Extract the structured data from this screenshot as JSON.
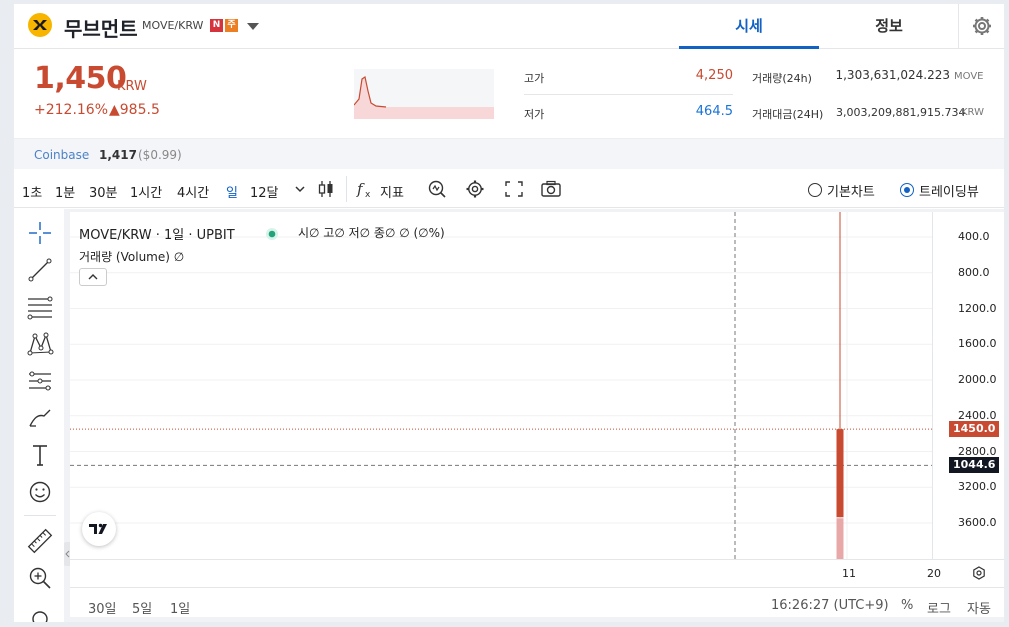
{
  "header": {
    "coin_name": "무브먼트",
    "pair": "MOVE/KRW",
    "badge_n": "N",
    "badge_j": "주",
    "tabs": [
      {
        "label": "시세"
      },
      {
        "label": "정보"
      }
    ]
  },
  "price": {
    "current": "1,450",
    "unit": "KRW",
    "change_pct": "+212.16%",
    "change_abs": "▲985.5"
  },
  "stats": {
    "high_label": "고가",
    "high_value": "4,250",
    "low_label": "저가",
    "low_value": "464.5",
    "volume_label": "거래량(24h)",
    "volume_value": "1,303,631,024.223",
    "volume_unit": "MOVE",
    "amount_label": "거래대금(24H)",
    "amount_value": "3,003,209,881,915.734",
    "amount_unit": "KRW"
  },
  "exchange": {
    "name": "Coinbase",
    "price": "1,417",
    "usd": "($0.99)"
  },
  "toolbar": {
    "timeframes": [
      "1초",
      "1분",
      "30분",
      "1시간",
      "4시간",
      "일",
      "12달"
    ],
    "active_timeframe": "일",
    "indicator_label": "지표",
    "radio_basic": "기본차트",
    "radio_trading": "트레이딩뷰"
  },
  "chart": {
    "legend_main": "MOVE/KRW · 1일 · UPBIT",
    "legend_ohlc": "시∅ 고∅ 저∅ 종∅ ∅ (∅%)",
    "legend_volume": "거래량 (Volume)  ∅",
    "y_ticks": [
      "3600.0",
      "3200.0",
      "2800.0",
      "2400.0",
      "2000.0",
      "1600.0",
      "1200.0",
      "800.0",
      "400.0"
    ],
    "x_ticks": [
      "11",
      "20"
    ],
    "last_price_tag": "1450.0",
    "crosshair_tag": "1044.6",
    "colors": {
      "up": "#c84a31",
      "accent": "#1261c4",
      "low": "#1a73d9"
    }
  },
  "chart_data": {
    "type": "candlestick",
    "title": "MOVE/KRW · 1일 · UPBIT",
    "ylim": [
      0,
      3900
    ],
    "candles": [
      {
        "x": "11",
        "open": 464.5,
        "high": 4250,
        "low": 464.5,
        "close": 1450
      }
    ],
    "x_ticks": [
      "11",
      "20"
    ],
    "y_ticks": [
      400,
      800,
      1200,
      1600,
      2000,
      2400,
      2800,
      3200,
      3600
    ]
  },
  "bottom": {
    "ranges": [
      "30일",
      "5일",
      "1일"
    ],
    "time": "16:26:27 (UTC+9)",
    "pct": "%",
    "log": "로그",
    "auto": "자동"
  }
}
